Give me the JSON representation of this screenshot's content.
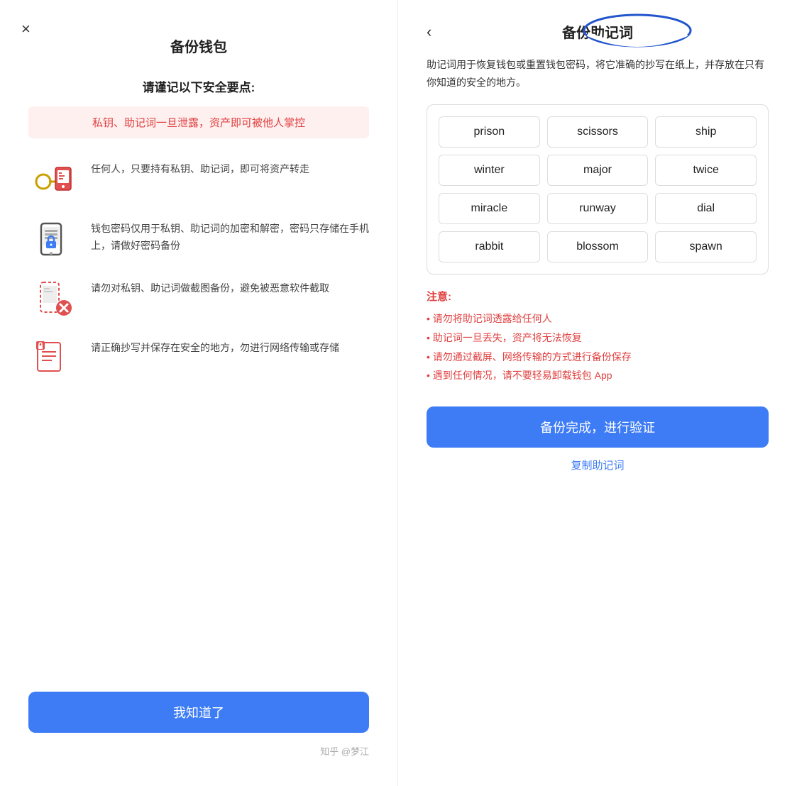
{
  "left": {
    "close_label": "×",
    "title": "备份钱包",
    "subtitle": "请谨记以下安全要点:",
    "warning": "私钥、助记词一旦泄露，资产即可被他人掌控",
    "features": [
      {
        "icon": "key-phone-icon",
        "text": "任何人，只要持有私钥、助记词，即可将资产转走"
      },
      {
        "icon": "phone-lock-icon",
        "text": "钱包密码仅用于私钥、助记词的加密和解密，密码只存储在手机上，请做好密码备份"
      },
      {
        "icon": "screenshot-ban-icon",
        "text": "请勿对私钥、助记词做截图备份，避免被恶意软件截取"
      },
      {
        "icon": "doc-save-icon",
        "text": "请正确抄写并保存在安全的地方，勿进行网络传输或存储"
      }
    ],
    "confirm_btn": "我知道了"
  },
  "right": {
    "back_label": "‹",
    "title": "备份助记词",
    "description": "助记词用于恢复钱包或重置钱包密码，将它准确的抄写在纸上，并存放在只有你知道的安全的地方。",
    "mnemonic_words": [
      "prison",
      "scissors",
      "ship",
      "winter",
      "major",
      "twice",
      "miracle",
      "runway",
      "dial",
      "rabbit",
      "blossom",
      "spawn"
    ],
    "notes_title": "注意:",
    "notes": [
      "• 请勿将助记词透露给任何人",
      "• 助记词一旦丢失，资产将无法恢复",
      "• 请勿通过截屏、网络传输的方式进行备份保存",
      "• 遇到任何情况，请不要轻易卸载钱包 App"
    ],
    "backup_btn": "备份完成，进行验证",
    "copy_link": "复制助记词"
  },
  "watermark": "知乎 @梦江"
}
